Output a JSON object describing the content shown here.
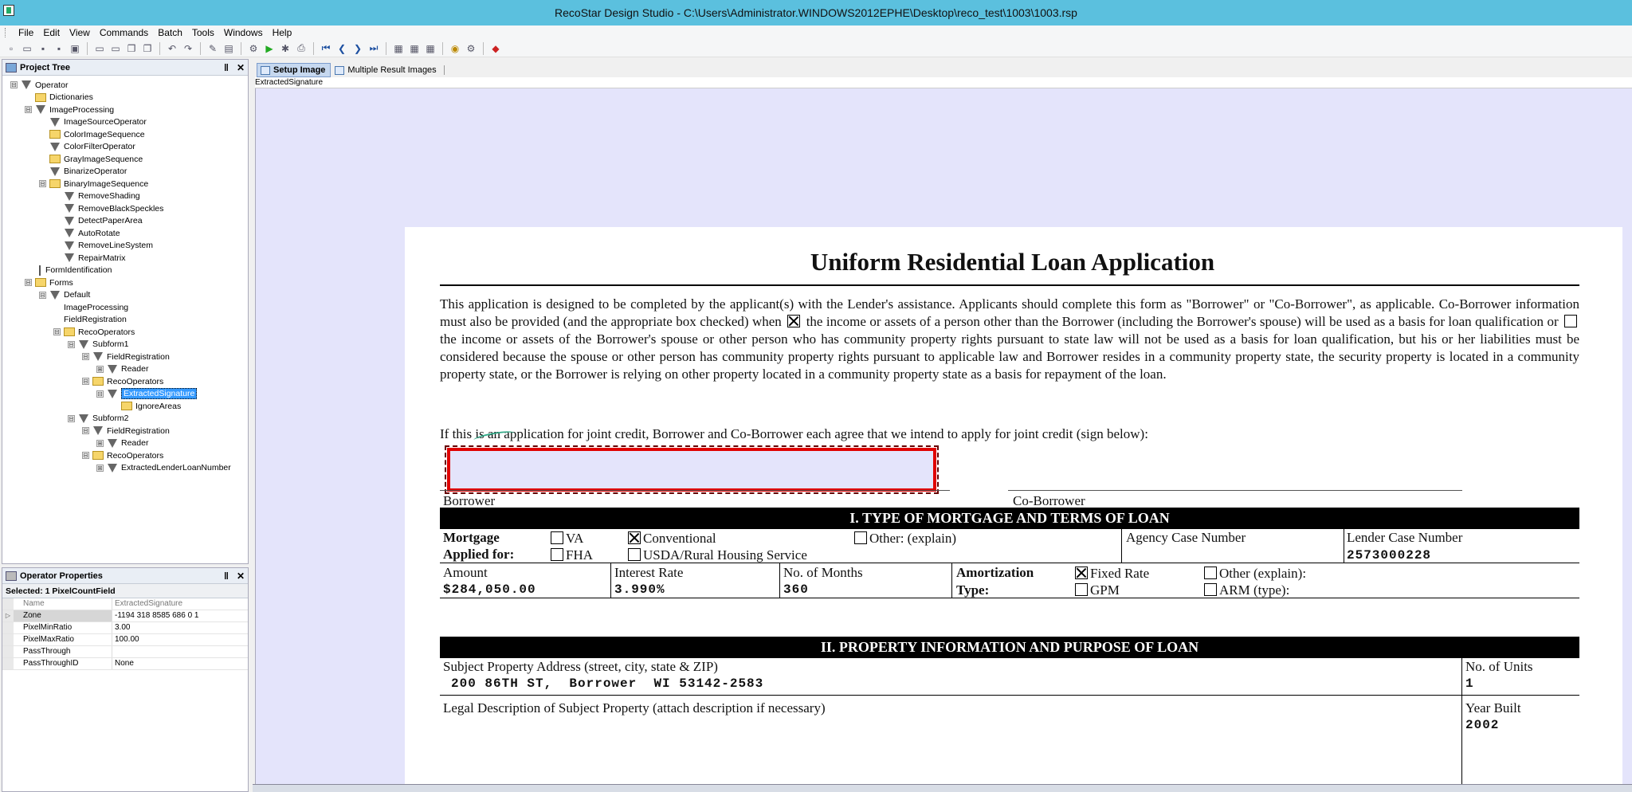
{
  "window": {
    "title": "RecoStar Design Studio - C:\\Users\\Administrator.WINDOWS2012EPHE\\Desktop\\reco_test\\1003\\1003.rsp"
  },
  "menu": [
    "File",
    "Edit",
    "View",
    "Commands",
    "Batch",
    "Tools",
    "Windows",
    "Help"
  ],
  "project_tree": {
    "title": "Project Tree",
    "pin": "‖",
    "close": "✕",
    "nodes": [
      {
        "label": "Operator",
        "level": 0,
        "exp": "⊟",
        "icon": "op"
      },
      {
        "label": "Dictionaries",
        "level": 1,
        "exp": "",
        "icon": "folder"
      },
      {
        "label": "ImageProcessing",
        "level": 1,
        "exp": "⊟",
        "icon": "op"
      },
      {
        "label": "ImageSourceOperator",
        "level": 2,
        "exp": "",
        "icon": "op"
      },
      {
        "label": "ColorImageSequence",
        "level": 2,
        "exp": "",
        "icon": "folder"
      },
      {
        "label": "ColorFilterOperator",
        "level": 2,
        "exp": "",
        "icon": "op"
      },
      {
        "label": "GrayImageSequence",
        "level": 2,
        "exp": "",
        "icon": "folder"
      },
      {
        "label": "BinarizeOperator",
        "level": 2,
        "exp": "",
        "icon": "op"
      },
      {
        "label": "BinaryImageSequence",
        "level": 2,
        "exp": "⊟",
        "icon": "folder"
      },
      {
        "label": "RemoveShading",
        "level": 3,
        "exp": "",
        "icon": "op"
      },
      {
        "label": "RemoveBlackSpeckles",
        "level": 3,
        "exp": "",
        "icon": "op"
      },
      {
        "label": "DetectPaperArea",
        "level": 3,
        "exp": "",
        "icon": "op"
      },
      {
        "label": "AutoRotate",
        "level": 3,
        "exp": "",
        "icon": "op"
      },
      {
        "label": "RemoveLineSystem",
        "level": 3,
        "exp": "",
        "icon": "op"
      },
      {
        "label": "RepairMatrix",
        "level": 3,
        "exp": "",
        "icon": "op"
      },
      {
        "label": "FormIdentification",
        "level": 1,
        "exp": "",
        "icon": "line"
      },
      {
        "label": "Forms",
        "level": 1,
        "exp": "⊟",
        "icon": "folder"
      },
      {
        "label": "Default",
        "level": 2,
        "exp": "⊟",
        "icon": "op"
      },
      {
        "label": "ImageProcessing",
        "level": 3,
        "exp": "",
        "icon": "none"
      },
      {
        "label": "FieldRegistration",
        "level": 3,
        "exp": "",
        "icon": "none"
      },
      {
        "label": "RecoOperators",
        "level": 3,
        "exp": "⊟",
        "icon": "folder"
      },
      {
        "label": "Subform1",
        "level": 4,
        "exp": "⊟",
        "icon": "op"
      },
      {
        "label": "FieldRegistration",
        "level": 5,
        "exp": "⊟",
        "icon": "op"
      },
      {
        "label": "Reader",
        "level": 6,
        "exp": "⊞",
        "icon": "op"
      },
      {
        "label": "RecoOperators",
        "level": 5,
        "exp": "⊟",
        "icon": "folder"
      },
      {
        "label": "ExtractedSignature",
        "level": 6,
        "exp": "⊟",
        "icon": "op",
        "selected": true
      },
      {
        "label": "IgnoreAreas",
        "level": 7,
        "exp": "",
        "icon": "folder"
      },
      {
        "label": "Subform2",
        "level": 4,
        "exp": "⊟",
        "icon": "op"
      },
      {
        "label": "FieldRegistration",
        "level": 5,
        "exp": "⊟",
        "icon": "op"
      },
      {
        "label": "Reader",
        "level": 6,
        "exp": "⊞",
        "icon": "op"
      },
      {
        "label": "RecoOperators",
        "level": 5,
        "exp": "⊟",
        "icon": "folder"
      },
      {
        "label": "ExtractedLenderLoanNumber",
        "level": 6,
        "exp": "⊞",
        "icon": "op"
      }
    ]
  },
  "operator_properties": {
    "title": "Operator Properties",
    "pin": "‖",
    "close": "✕",
    "selected": "Selected: 1 PixelCountField",
    "header": {
      "name": "Name",
      "value": "ExtractedSignature"
    },
    "rows": [
      {
        "name": "Zone",
        "value": "-1194 318 8585 686 0 1",
        "gut": "▷"
      },
      {
        "name": "PixelMinRatio",
        "value": "3.00",
        "gut": ""
      },
      {
        "name": "PixelMaxRatio",
        "value": "100.00",
        "gut": ""
      },
      {
        "name": "PassThrough",
        "value": "",
        "gut": ""
      },
      {
        "name": "PassThroughID",
        "value": "None",
        "gut": ""
      }
    ]
  },
  "tabs": [
    {
      "label": "Setup Image",
      "active": true
    },
    {
      "label": "Multiple Result Images",
      "active": false
    }
  ],
  "subtab_label": "ExtractedSignature",
  "document": {
    "title": "Uniform Residential Loan Application",
    "para1": "This application is designed to be completed by the applicant(s) with the Lender's assistance. Applicants should complete this form as \"Borrower\" or \"Co-Borrower\", as applicable. Co-Borrower information must also be provided (and the appropriate box checked) when",
    "para2": "the income or assets of a person other than the Borrower (including the Borrower's spouse) will be used as a basis for loan qualification or",
    "para3": "the income or assets of the Borrower's spouse or other person who has community property rights pursuant to state law will not be used as a basis for loan qualification, but his or her liabilities must be considered because the spouse or other person has community property rights pursuant to applicable law and Borrower resides in a community property state, the security property is located in a community property state, or the Borrower is relying on other property located in a community property state as a basis for repayment of the loan.",
    "joint": "If this is an application for joint credit, Borrower and Co-Borrower each agree that we intend to apply for joint credit (sign below):",
    "borrower": "Borrower",
    "coborrower": "Co-Borrower",
    "section1": "I. TYPE OF MORTGAGE AND TERMS OF LOAN",
    "mortgage_label1": "Mortgage",
    "mortgage_label2": "Applied for:",
    "va": "VA",
    "fha": "FHA",
    "conventional": "Conventional",
    "usda": "USDA/Rural Housing Service",
    "other_explain": "Other: (explain)",
    "agency_case": "Agency Case Number",
    "lender_case": "Lender Case Number",
    "lender_case_value": "2573000228",
    "amount_label": "Amount",
    "amount_value": "$284,050.00",
    "rate_label": "Interest Rate",
    "rate_value": "3.990%",
    "months_label": "No. of Months",
    "months_value": "360",
    "amort_label1": "Amortization",
    "amort_label2": "Type:",
    "fixed_rate": "Fixed Rate",
    "gpm": "GPM",
    "other_explain2": "Other (explain):",
    "arm": "ARM (type):",
    "section2": "II. PROPERTY INFORMATION AND PURPOSE OF LOAN",
    "subject_label": "Subject Property Address (street, city, state & ZIP)",
    "subject_value": "200 86TH ST,  Borrower  WI 53142-2583",
    "units_label": "No. of Units",
    "units_value": "1",
    "legal_label": "Legal Description of Subject Property (attach description if necessary)",
    "year_label": "Year Built",
    "year_value": "2002"
  }
}
